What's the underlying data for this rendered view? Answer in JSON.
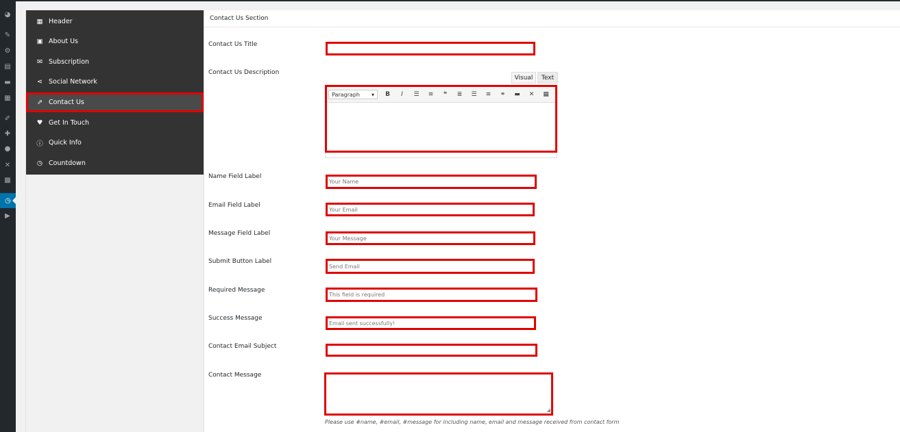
{
  "nav": {
    "items": [
      {
        "label": "Header",
        "icon": "layout-icon"
      },
      {
        "label": "About Us",
        "icon": "id-card-icon"
      },
      {
        "label": "Subscription",
        "icon": "envelope-icon"
      },
      {
        "label": "Social Network",
        "icon": "share-icon"
      },
      {
        "label": "Contact Us",
        "icon": "external-link-icon"
      },
      {
        "label": "Get In Touch",
        "icon": "heart-icon"
      },
      {
        "label": "Quick Info",
        "icon": "info-icon"
      },
      {
        "label": "Countdown",
        "icon": "clock-icon"
      }
    ],
    "active": "Contact Us"
  },
  "section": {
    "title": "Contact Us Section"
  },
  "fields": {
    "title_label": "Contact Us Title",
    "title_value": "",
    "description_label": "Contact Us Description",
    "name_label": "Name Field Label",
    "name_value": "Your Name",
    "email_label": "Email Field Label",
    "email_value": "Your Email",
    "message_label": "Message Field Label",
    "message_value": "Your Message",
    "submit_label": "Submit Button Label",
    "submit_value": "Send Email",
    "required_label": "Required Message",
    "required_value": "This field is required",
    "success_label": "Success Message",
    "success_value": "Email sent successfully!",
    "subject_label": "Contact Email Subject",
    "subject_value": "",
    "contact_message_label": "Contact Message",
    "contact_message_hint": "Please use #name, #email, #message for including name, email and message received from contact form"
  },
  "editor": {
    "tab_visual": "Visual",
    "tab_text": "Text",
    "format_select": "Paragraph",
    "toolbar_icons": [
      "bold-icon",
      "italic-icon",
      "bullet-list-icon",
      "numbered-list-icon",
      "blockquote-icon",
      "align-left-icon",
      "align-center-icon",
      "align-right-icon",
      "link-icon",
      "read-more-icon",
      "fullscreen-icon",
      "toolbar-toggle-icon"
    ]
  },
  "colors": {
    "highlight": "#e00000",
    "admin_bar": "#23282d",
    "admin_active": "#0073aa",
    "nav_bg": "#333333"
  }
}
